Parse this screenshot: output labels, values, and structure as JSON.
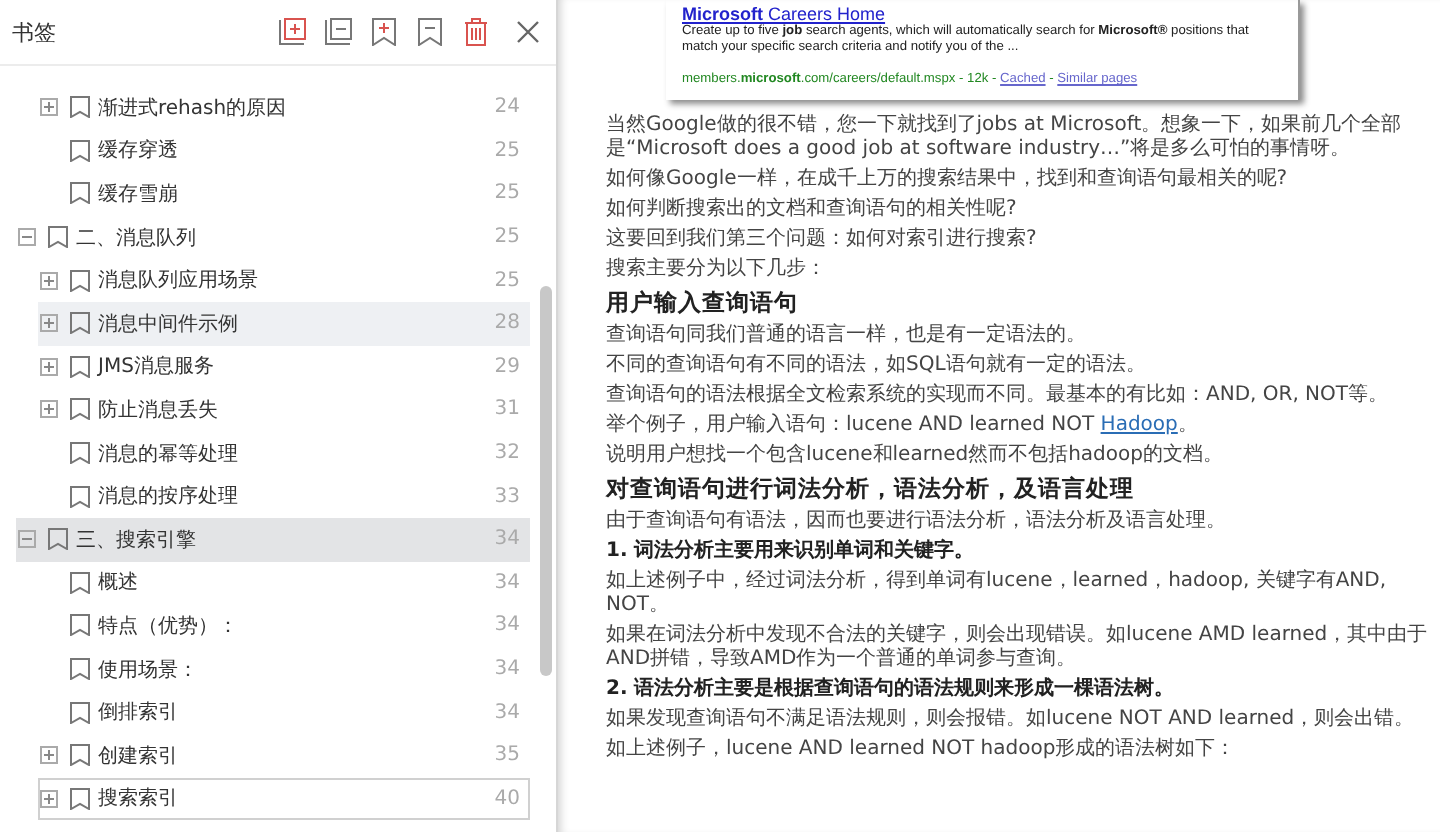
{
  "panel": {
    "title": "书签"
  },
  "toolbar": [
    {
      "kind": "expand-all"
    },
    {
      "kind": "collapse-all"
    },
    {
      "kind": "add"
    },
    {
      "kind": "remove"
    },
    {
      "kind": "delete"
    },
    {
      "kind": "close"
    }
  ],
  "bookmarks": {
    "continued": [
      {
        "label": "渐进式rehash的原因",
        "page": "24",
        "kind": "branch",
        "expanded": false,
        "selected": false,
        "hovered": false,
        "focused": false
      },
      {
        "label": "缓存穿透",
        "page": "25",
        "kind": "leaf",
        "selected": false,
        "hovered": false,
        "focused": false
      },
      {
        "label": "缓存雪崩",
        "page": "25",
        "kind": "leaf",
        "selected": false,
        "hovered": false,
        "focused": false
      }
    ],
    "items": [
      {
        "label": "二、消息队列",
        "page": "25",
        "kind": "branch",
        "expanded": true,
        "selected": false,
        "hovered": false,
        "focused": false,
        "children": [
          {
            "label": "消息队列应用场景",
            "page": "25",
            "kind": "branch",
            "expanded": false,
            "selected": false,
            "hovered": false,
            "focused": false
          },
          {
            "label": "消息中间件示例",
            "page": "28",
            "kind": "branch",
            "expanded": false,
            "selected": false,
            "hovered": true,
            "focused": false
          },
          {
            "label": "JMS消息服务",
            "page": "29",
            "kind": "branch",
            "expanded": false,
            "selected": false,
            "hovered": false,
            "focused": false
          },
          {
            "label": "防止消息丢失",
            "page": "31",
            "kind": "branch",
            "expanded": false,
            "selected": false,
            "hovered": false,
            "focused": false
          },
          {
            "label": "消息的幂等处理",
            "page": "32",
            "kind": "leaf",
            "selected": false,
            "hovered": false,
            "focused": false
          },
          {
            "label": "消息的按序处理",
            "page": "33",
            "kind": "leaf",
            "selected": false,
            "hovered": false,
            "focused": false
          }
        ]
      },
      {
        "label": "三、搜索引擎",
        "page": "34",
        "kind": "branch",
        "expanded": true,
        "selected": true,
        "hovered": false,
        "focused": false,
        "children": [
          {
            "label": "概述",
            "page": "34",
            "kind": "leaf",
            "selected": false,
            "hovered": false,
            "focused": false
          },
          {
            "label": "特点（优势）：",
            "page": "34",
            "kind": "leaf",
            "selected": false,
            "hovered": false,
            "focused": false
          },
          {
            "label": "使用场景：",
            "page": "34",
            "kind": "leaf",
            "selected": false,
            "hovered": false,
            "focused": false
          },
          {
            "label": "倒排索引",
            "page": "34",
            "kind": "leaf",
            "selected": false,
            "hovered": false,
            "focused": false
          },
          {
            "label": "创建索引",
            "page": "35",
            "kind": "branch",
            "expanded": false,
            "selected": false,
            "hovered": false,
            "focused": false
          },
          {
            "label": "搜索索引",
            "page": "40",
            "kind": "branch",
            "expanded": false,
            "selected": false,
            "hovered": false,
            "focused": true
          }
        ]
      }
    ]
  },
  "search_result": {
    "title_bold": "Microsoft",
    "title_rest": " Careers Home",
    "snippet": "Create up to five **job** search agents, which will automatically search for **Microsoft®** positions that match your specific search criteria and notify you of the ...",
    "url": "members.**microsoft**.com/careers/default.mspx - 12k - ",
    "links": [
      "Cached",
      "Similar pages"
    ],
    "link_separator": " - "
  },
  "document": [
    {
      "kind": "paragraph",
      "text": "当然Google做的很不错，您一下就找到了jobs at Microsoft。想象一下，如果前几个全部是“Microsoft does a good job at software industry…”将是多么可怕的事情呀。"
    },
    {
      "kind": "paragraph",
      "text": "如何像Google一样，在成千上万的搜索结果中，找到和查询语句最相关的呢?"
    },
    {
      "kind": "paragraph",
      "text": "如何判断搜索出的文档和查询语句的相关性呢?"
    },
    {
      "kind": "paragraph",
      "text": "这要回到我们第三个问题：如何对索引进行搜索?"
    },
    {
      "kind": "paragraph",
      "text": "搜索主要分为以下几步："
    },
    {
      "kind": "heading",
      "text": "用户输入查询语句"
    },
    {
      "kind": "paragraph",
      "text": "查询语句同我们普通的语言一样，也是有一定语法的。"
    },
    {
      "kind": "paragraph",
      "text": "不同的查询语句有不同的语法，如SQL语句就有一定的语法。"
    },
    {
      "kind": "paragraph",
      "text": "查询语句的语法根据全文检索系统的实现而不同。最基本的有比如：AND, OR, NOT等。"
    },
    {
      "kind": "paragraph",
      "text": "举个例子，用户输入语句：lucene AND learned NOT ",
      "link": "Hadoop",
      "after": "。"
    },
    {
      "kind": "paragraph",
      "text": "说明用户想找一个包含lucene和learned然而不包括hadoop的文档。"
    },
    {
      "kind": "heading",
      "text": "对查询语句进行词法分析，语法分析，及语言处理"
    },
    {
      "kind": "paragraph",
      "text": "由于查询语句有语法，因而也要进行语法分析，语法分析及语言处理。"
    },
    {
      "kind": "subheading",
      "text": "1. 词法分析主要用来识别单词和关键字。"
    },
    {
      "kind": "paragraph",
      "text": "如上述例子中，经过词法分析，得到单词有lucene，learned，hadoop, 关键字有AND, NOT。"
    },
    {
      "kind": "paragraph",
      "text": "如果在词法分析中发现不合法的关键字，则会出现错误。如lucene AMD learned，其中由于AND拼错，导致AMD作为一个普通的单词参与查询。"
    },
    {
      "kind": "subheading",
      "text": "2. 语法分析主要是根据查询语句的语法规则来形成一棵语法树。"
    },
    {
      "kind": "paragraph",
      "text": "如果发现查询语句不满足语法规则，则会报错。如lucene NOT AND learned，则会出错。"
    },
    {
      "kind": "paragraph",
      "text": "如上述例子，lucene AND learned NOT hadoop形成的语法树如下："
    }
  ]
}
